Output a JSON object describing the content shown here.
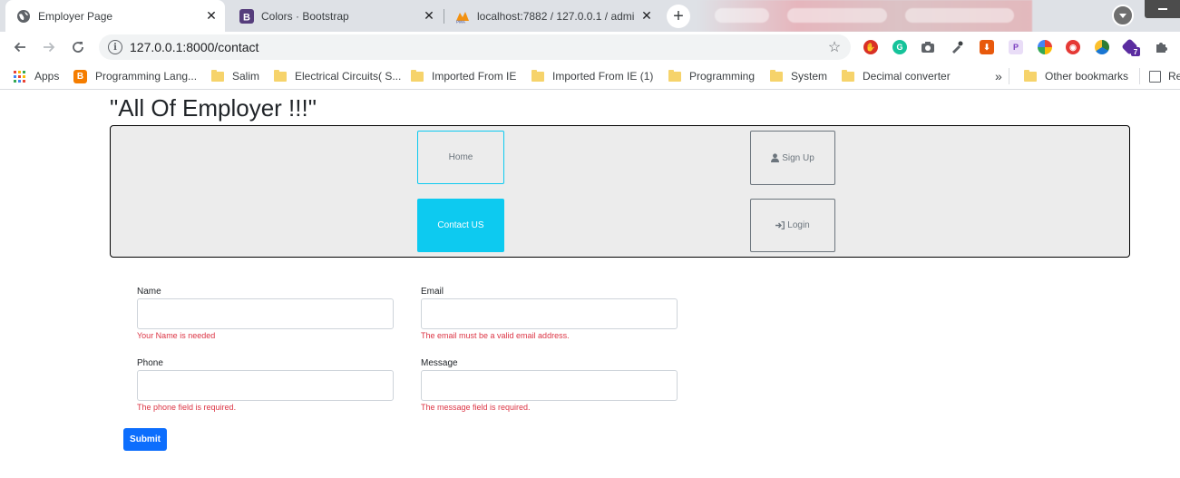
{
  "browser": {
    "tabs": [
      {
        "title": "Employer Page",
        "icon": "globe-icon",
        "active": true
      },
      {
        "title": "Colors · Bootstrap",
        "icon": "bootstrap-icon",
        "active": false
      },
      {
        "title": "localhost:7882 / 127.0.0.1 / admi",
        "icon": "phpmyadmin-icon",
        "active": false
      }
    ],
    "close_glyph": "✕",
    "new_tab_glyph": "+",
    "url": "127.0.0.1:8000/contact",
    "bookmarks": [
      {
        "label": "Apps",
        "icon": "apps-grid-icon"
      },
      {
        "label": "Programming Lang...",
        "icon": "blogger-icon"
      },
      {
        "label": "Salim",
        "icon": "folder-icon"
      },
      {
        "label": "Electrical Circuits( S...",
        "icon": "folder-icon"
      },
      {
        "label": "Imported From IE",
        "icon": "folder-icon"
      },
      {
        "label": "Imported From IE (1)",
        "icon": "folder-icon"
      },
      {
        "label": "Programming",
        "icon": "folder-icon"
      },
      {
        "label": "System",
        "icon": "folder-icon"
      },
      {
        "label": "Decimal converter",
        "icon": "folder-icon"
      }
    ],
    "overflow_glyph": "»",
    "other_bookmarks": "Other bookmarks",
    "reading_list_partial": "Re",
    "extension_badge": "7",
    "accent_color": "#1a73e8"
  },
  "page": {
    "title": "\"All Of Employer !!!\"",
    "nav": {
      "home": "Home",
      "signup": "Sign Up",
      "contact": "Contact US",
      "login": "Login",
      "active_color": "#0dcaf0"
    },
    "form": {
      "name_label": "Name",
      "name_error": "Your Name is needed",
      "email_label": "Email",
      "email_error": "The email must be a valid email address.",
      "phone_label": "Phone",
      "phone_error": "The phone field is required.",
      "message_label": "Message",
      "message_error": "The message field is required.",
      "submit": "Submit",
      "error_color": "#dc3545",
      "submit_color": "#0d6efd"
    }
  }
}
